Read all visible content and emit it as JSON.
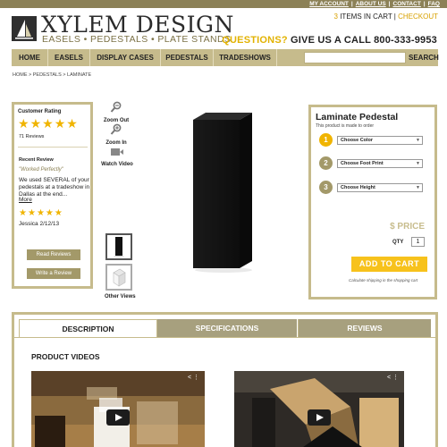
{
  "top_links": [
    "MY ACCOUNT",
    "ABOUT US",
    "CONTACT",
    "FAQ"
  ],
  "header": {
    "brand": "XYLEM DESIGN",
    "tagline": "EASELS • PEDESTALS • PLATE STANDS",
    "cart_count": "3",
    "cart_label": " ITEMS IN CART | ",
    "checkout": "CHECKOUT",
    "questions": "QUESTIONS?",
    "call_label": " GIVE US A CALL 800-333-9953"
  },
  "nav": {
    "items": [
      "HOME",
      "EASELS",
      "DISPLAY CASES",
      "PEDESTALS",
      "TRADESHOWS"
    ],
    "search_value": "",
    "search_button": "SEARCH"
  },
  "breadcrumb": "HOME > PEDESTALS > LAMINATE",
  "rating": {
    "title": "Customer Rating",
    "stars": 5,
    "count": "71 Reviews",
    "recent_label": "Recent Review",
    "quote": "\"Worked Perfectly\"",
    "body": "We used SEVERAL of your pedestals at a tradeshow in Dallas at the end...",
    "more": "More",
    "review_stars": 5,
    "author": "Jessica 2/12/13",
    "read_button": "Read Reviews",
    "write_button": "Write a Review"
  },
  "tools": {
    "zoom_out": "Zoom Out",
    "zoom_in": "Zoom In",
    "watch_video": "Watch Video",
    "other_views": "Other Views"
  },
  "order": {
    "title": "Laminate Pedestal",
    "subtitle": "This product is made to order",
    "steps": [
      {
        "number": "1",
        "label": "Choose Color",
        "color": "#f0b400"
      },
      {
        "number": "2",
        "label": "Choose Foot Print",
        "color": "#a39969"
      },
      {
        "number": "3",
        "label": "Choose Height",
        "color": "#a39969"
      }
    ],
    "price": "$ PRICE",
    "qty_label": "QTY",
    "qty_value": "1",
    "add_to_cart": "ADD TO CART",
    "shipping_note": "Calculate shipping in the shopping cart"
  },
  "tabs": {
    "items": [
      "DESCRIPTION",
      "SPECIFICATIONS",
      "REVIEWS"
    ],
    "active": "DESCRIPTION",
    "section_title": "PRODUCT VIDEOS"
  },
  "colors": {
    "accent_gold": "#f7c21c",
    "khaki": "#c6bb8c",
    "dark_khaki": "#8c8157"
  },
  "icons": [
    "logo-sail-icon",
    "zoom-out-icon",
    "zoom-in-icon",
    "video-camera-icon",
    "play-icon",
    "share-icon",
    "star-icon"
  ]
}
